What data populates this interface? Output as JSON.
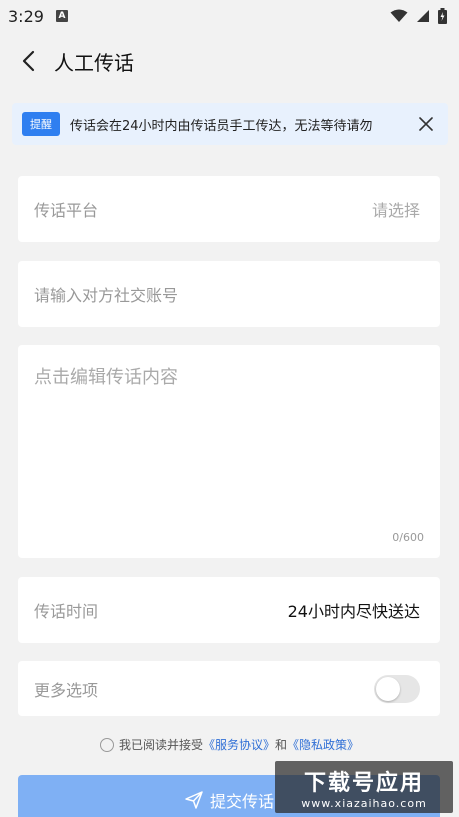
{
  "status_bar": {
    "time": "3:29",
    "notification_letter": "A"
  },
  "header": {
    "title": "人工传话"
  },
  "notice": {
    "badge": "提醒",
    "text": "传话会在24小时内由传话员手工传达，无法等待请勿"
  },
  "form": {
    "platform": {
      "label": "传话平台",
      "placeholder": "请选择"
    },
    "account": {
      "placeholder": "请输入对方社交账号"
    },
    "content": {
      "placeholder": "点击编辑传话内容",
      "counter": "0/600"
    },
    "time": {
      "label": "传话时间",
      "value": "24小时内尽快送达"
    },
    "more": {
      "label": "更多选项",
      "toggle_on": false
    }
  },
  "agreement": {
    "prefix": "我已阅读并接受",
    "service": "《服务协议》",
    "and": "和",
    "privacy": "《隐私政策》"
  },
  "submit": {
    "label": "提交传话"
  },
  "watermark": {
    "main": "下载号应用",
    "sub": "www.xiazaihao.com"
  },
  "colors": {
    "accent": "#2f7ff0",
    "submit_bg": "#7fb0f4",
    "notice_bg": "#e8f1fd"
  },
  "icons": [
    "back-arrow-icon",
    "close-icon",
    "send-icon",
    "wifi-icon",
    "signal-icon",
    "battery-icon"
  ]
}
